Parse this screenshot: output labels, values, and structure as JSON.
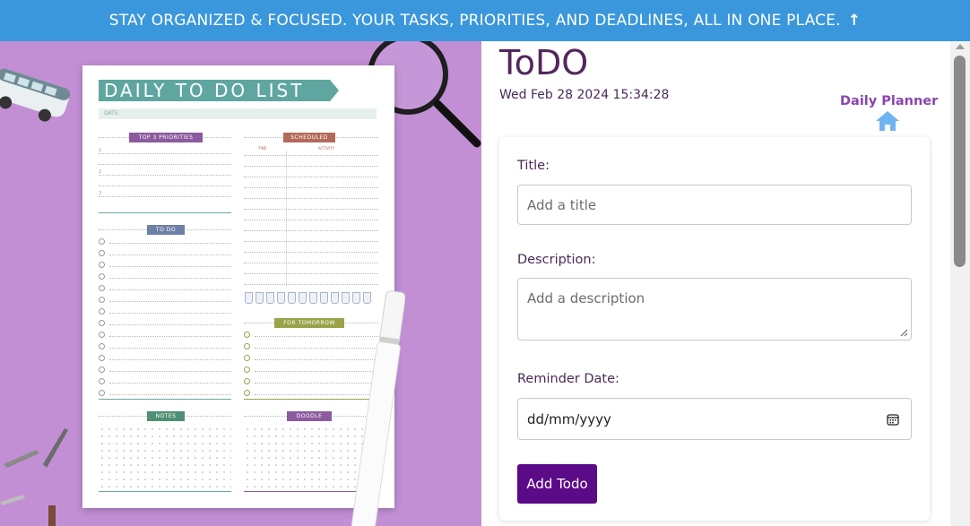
{
  "banner": {
    "text": "STAY ORGANIZED & FOCUSED. YOUR TASKS, PRIORITIES, AND DEADLINES, ALL IN ONE PLACE.",
    "arrow": "↑"
  },
  "illustration": {
    "sheet_title": "DAILY TO DO LIST",
    "date_label": "DATE:",
    "sections": {
      "priorities": "TOP 3 PRIORITIES",
      "scheduled": "SCHEDULED",
      "time": "TIME",
      "activity": "ACTIVITY",
      "todo": "TO DO",
      "for_tomorrow": "FOR TOMORROW",
      "notes": "NOTES",
      "doodle": "DOODLE"
    },
    "priority_numbers": [
      "1",
      "2",
      "3"
    ]
  },
  "header": {
    "title": "ToDO",
    "datetime": "Wed Feb 28 2024 15:34:28",
    "planner_link": "Daily Planner"
  },
  "form": {
    "title_label": "Title:",
    "title_placeholder": "Add a title",
    "description_label": "Description:",
    "description_placeholder": "Add a description",
    "reminder_label": "Reminder Date:",
    "reminder_value": "dd/mm/yyyy",
    "submit_label": "Add Todo"
  },
  "colors": {
    "banner": "#3a97dc",
    "accent": "#5b0a88",
    "title": "#53265d",
    "hero_bg": "#c28fd5",
    "link": "#8a44b0",
    "home_icon": "#6fb3f2"
  },
  "icons": [
    "arrow-up-icon",
    "home-icon",
    "caret-down-icon",
    "calendar-icon",
    "resize-handle-icon"
  ]
}
